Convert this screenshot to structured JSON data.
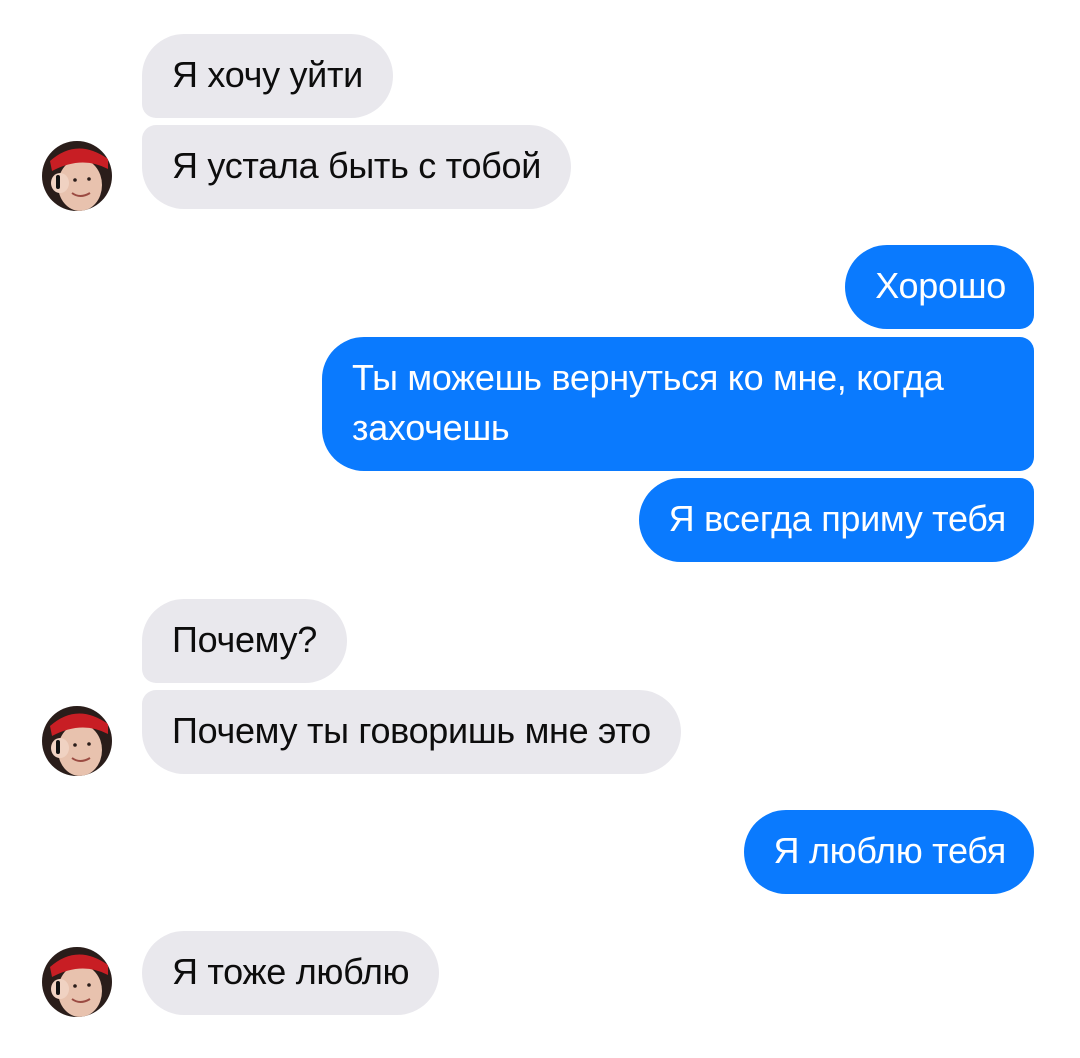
{
  "chat": {
    "messages": [
      {
        "sender": "them",
        "text": "Я хочу уйти"
      },
      {
        "sender": "them",
        "text": "Я устала быть с тобой"
      },
      {
        "sender": "me",
        "text": "Хорошо"
      },
      {
        "sender": "me",
        "text": "Ты можешь вернуться ко мне, когда захочешь"
      },
      {
        "sender": "me",
        "text": "Я всегда приму тебя"
      },
      {
        "sender": "them",
        "text": "Почему?"
      },
      {
        "sender": "them",
        "text": "Почему ты говоришь мне это"
      },
      {
        "sender": "me",
        "text": "Я люблю тебя"
      },
      {
        "sender": "them",
        "text": "Я тоже люблю"
      }
    ]
  },
  "colors": {
    "incoming_bubble": "#e9e8ed",
    "outgoing_bubble": "#0a7afe",
    "incoming_text": "#0d0d0d",
    "outgoing_text": "#ffffff"
  },
  "icons": {
    "contact_avatar": "contact-avatar-photo"
  }
}
